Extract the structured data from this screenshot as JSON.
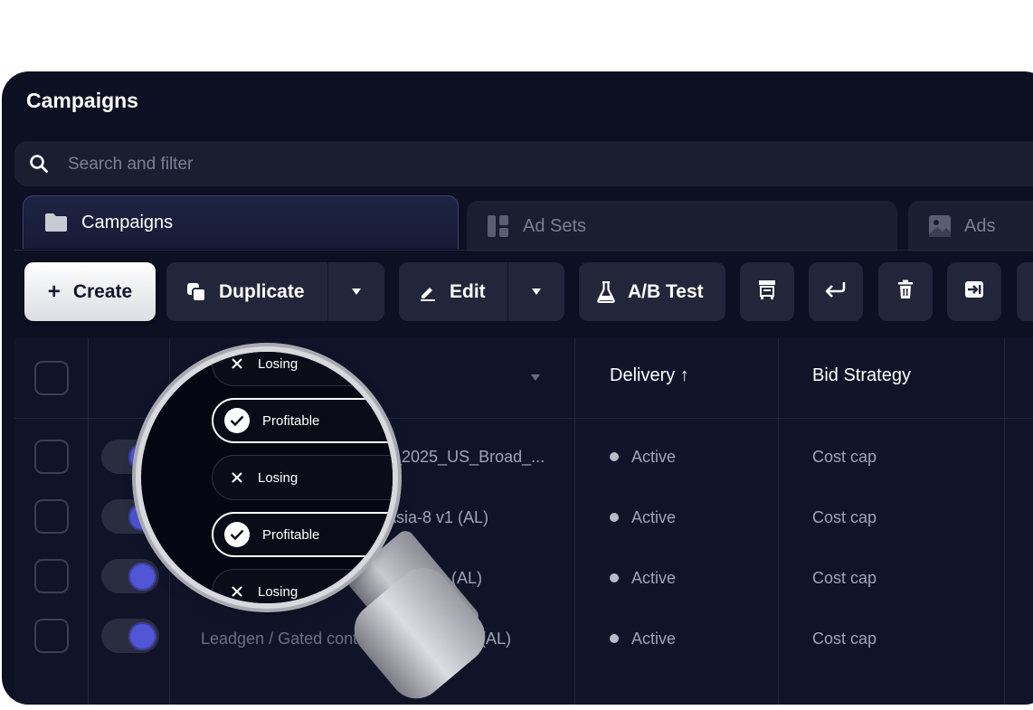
{
  "header": {
    "title": "Campaigns"
  },
  "search": {
    "placeholder": "Search and filter"
  },
  "tabs": [
    {
      "label": "Campaigns",
      "icon": "folder-icon",
      "active": true
    },
    {
      "label": "Ad Sets",
      "icon": "grid-icon",
      "active": false
    },
    {
      "label": "Ads",
      "icon": "image-icon",
      "active": false
    }
  ],
  "toolbar": {
    "create": "Create",
    "duplicate": "Duplicate",
    "edit": "Edit",
    "ab_test": "A/B Test"
  },
  "table": {
    "columns": {
      "delivery": "Delivery ↑",
      "bid_strategy": "Bid Strategy"
    },
    "rows": [
      {
        "name": "_2025_US_Broad_...",
        "delivery": "Active",
        "bid_strategy": "Cost cap"
      },
      {
        "name": "Asia-8 v1 (AL)",
        "delivery": "Active",
        "bid_strategy": "Cost cap"
      },
      {
        "name": "lia-7 v1 (AL)",
        "delivery": "Active",
        "bid_strategy": "Cost cap"
      },
      {
        "name": "Leadgen / Gated content",
        "name_suffix": "l (AL)",
        "delivery": "Active",
        "bid_strategy": "Cost cap"
      }
    ]
  },
  "magnifier": {
    "pills": [
      {
        "label": "Losing",
        "status": "losing"
      },
      {
        "label": "Profitable",
        "status": "profitable"
      },
      {
        "label": "Losing",
        "status": "losing"
      },
      {
        "label": "Profitable",
        "status": "profitable"
      },
      {
        "label": "Losing",
        "status": "losing"
      }
    ]
  },
  "colors": {
    "background": "#0d0f22",
    "toggle_on": "#5056d6",
    "surface": "#23263a"
  }
}
